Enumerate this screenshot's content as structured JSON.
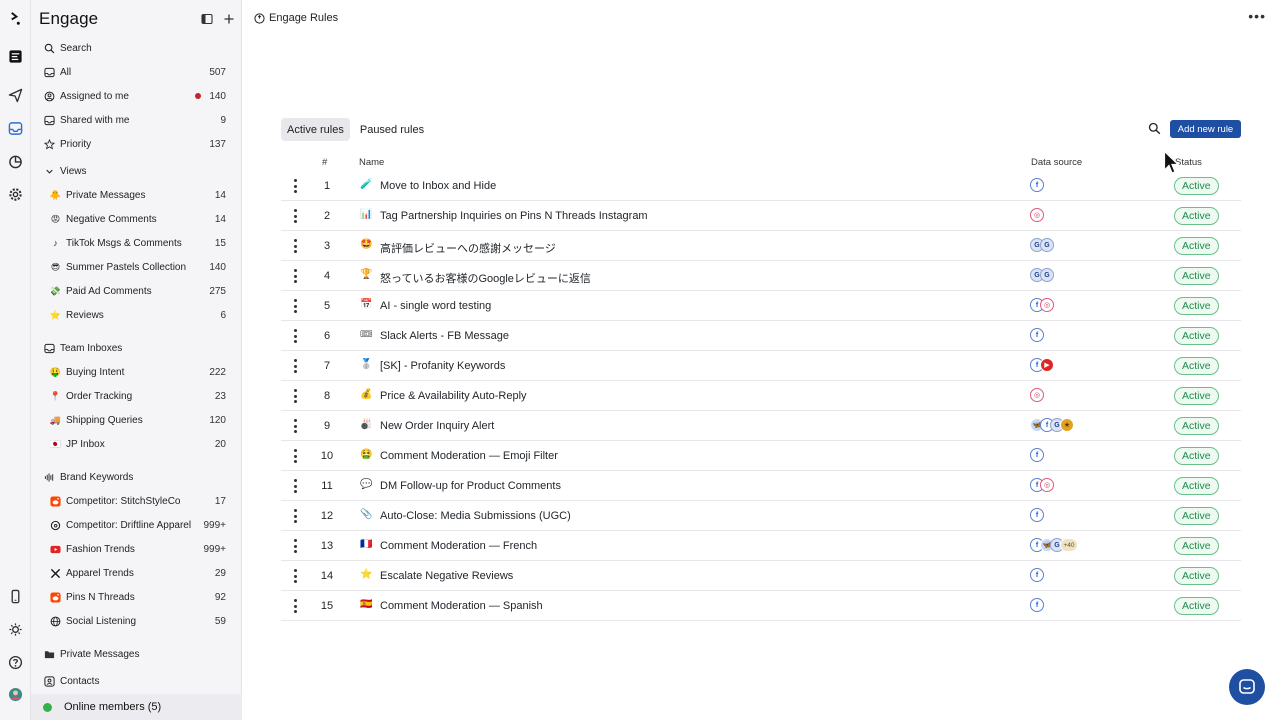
{
  "sidebar": {
    "title": "Engage",
    "top_items": [
      {
        "label": "Search",
        "count": "",
        "icon": "search-icon"
      },
      {
        "label": "All",
        "count": "507",
        "icon": "inbox-icon"
      },
      {
        "label": "Assigned to me",
        "count": "140",
        "icon": "user-circle-icon",
        "unread_dot": true
      },
      {
        "label": "Shared with me",
        "count": "9",
        "icon": "shared-inbox-icon"
      },
      {
        "label": "Priority",
        "count": "137",
        "icon": "star-icon"
      }
    ],
    "views_label": "Views",
    "views": [
      {
        "label": "Private Messages",
        "count": "14",
        "emoji": "🐥"
      },
      {
        "label": "Negative Comments",
        "count": "14",
        "emoji": "😡"
      },
      {
        "label": "TikTok Msgs & Comments",
        "count": "15",
        "emoji": "♪"
      },
      {
        "label": "Summer Pastels Collection",
        "count": "140",
        "emoji": "😎"
      },
      {
        "label": "Paid Ad Comments",
        "count": "275",
        "emoji": "💸"
      },
      {
        "label": "Reviews",
        "count": "6",
        "emoji": "⭐"
      }
    ],
    "team_label": "Team Inboxes",
    "team": [
      {
        "label": "Buying Intent",
        "count": "222",
        "emoji": "🤑"
      },
      {
        "label": "Order Tracking",
        "count": "23",
        "emoji": "📍"
      },
      {
        "label": "Shipping Queries",
        "count": "120",
        "emoji": "🚚"
      },
      {
        "label": "JP Inbox",
        "count": "20",
        "emoji": "🇯🇵"
      }
    ],
    "brand_label": "Brand Keywords",
    "brand": [
      {
        "label": "Competitor: StitchStyleCo",
        "count": "17",
        "icon": "reddit-icon"
      },
      {
        "label": "Competitor: Driftline Apparel",
        "count": "999+",
        "icon": "threads-icon"
      },
      {
        "label": "Fashion Trends",
        "count": "999+",
        "icon": "youtube-icon"
      },
      {
        "label": "Apparel Trends",
        "count": "29",
        "icon": "x-icon"
      },
      {
        "label": "Pins N Threads",
        "count": "92",
        "icon": "reddit-icon"
      },
      {
        "label": "Social Listening",
        "count": "59",
        "icon": "globe-icon"
      }
    ],
    "private_messages": "Private Messages",
    "contacts": "Contacts",
    "online_members": "Online members (5)"
  },
  "main": {
    "breadcrumb": "Engage Rules",
    "tabs": [
      {
        "label": "Active rules",
        "active": true
      },
      {
        "label": "Paused rules",
        "active": false
      }
    ],
    "add_button": "Add new rule",
    "columns": {
      "num": "#",
      "name": "Name",
      "source": "Data source",
      "status": "Status"
    },
    "rules": [
      {
        "num": "1",
        "emoji": "🧪",
        "name": "Move to Inbox and Hide",
        "sources": [
          "fb"
        ],
        "status": "Active"
      },
      {
        "num": "2",
        "emoji": "📊",
        "name": "Tag Partnership Inquiries on Pins N Threads Instagram",
        "sources": [
          "ig"
        ],
        "status": "Active"
      },
      {
        "num": "3",
        "emoji": "🤩",
        "name": "高評価レビューへの感謝メッセージ",
        "sources": [
          "g",
          "g"
        ],
        "status": "Active"
      },
      {
        "num": "4",
        "emoji": "🏆",
        "name": "怒っているお客様のGoogleレビューに返信",
        "sources": [
          "g",
          "g"
        ],
        "status": "Active"
      },
      {
        "num": "5",
        "emoji": "📅",
        "name": "AI - single word testing",
        "sources": [
          "fb",
          "ig"
        ],
        "status": "Active"
      },
      {
        "num": "6",
        "emoji": "🎟",
        "name": "Slack Alerts - FB Message",
        "sources": [
          "fb"
        ],
        "status": "Active"
      },
      {
        "num": "7",
        "emoji": "🥈",
        "name": "[SK] - Profanity Keywords",
        "sources": [
          "fb",
          "yt"
        ],
        "status": "Active"
      },
      {
        "num": "8",
        "emoji": "💰",
        "name": "Price & Availability Auto-Reply",
        "sources": [
          "ig"
        ],
        "status": "Active"
      },
      {
        "num": "9",
        "emoji": "🎳",
        "name": "New Order Inquiry Alert",
        "sources": [
          "bs",
          "fb",
          "g",
          "gold"
        ],
        "status": "Active"
      },
      {
        "num": "10",
        "emoji": "🤮",
        "name": "Comment Moderation — Emoji Filter",
        "sources": [
          "fb"
        ],
        "status": "Active"
      },
      {
        "num": "11",
        "emoji": "💬",
        "name": "DM Follow-up for Product Comments",
        "sources": [
          "fb",
          "ig"
        ],
        "status": "Active"
      },
      {
        "num": "12",
        "emoji": "📎",
        "name": "Auto-Close: Media Submissions (UGC)",
        "sources": [
          "fb"
        ],
        "status": "Active"
      },
      {
        "num": "13",
        "emoji": "🇫🇷",
        "name": "Comment Moderation — French",
        "sources": [
          "fb",
          "bs",
          "g",
          "+40"
        ],
        "status": "Active"
      },
      {
        "num": "14",
        "emoji": "⭐",
        "name": "Escalate Negative Reviews",
        "sources": [
          "fb"
        ],
        "status": "Active"
      },
      {
        "num": "15",
        "emoji": "🇪🇸",
        "name": "Comment Moderation — Spanish",
        "sources": [
          "fb"
        ],
        "status": "Active"
      }
    ]
  },
  "colors": {
    "accent": "#1f4fa3",
    "active_green": "#1e8a4b",
    "unread": "#c1272d",
    "online": "#33b249"
  }
}
